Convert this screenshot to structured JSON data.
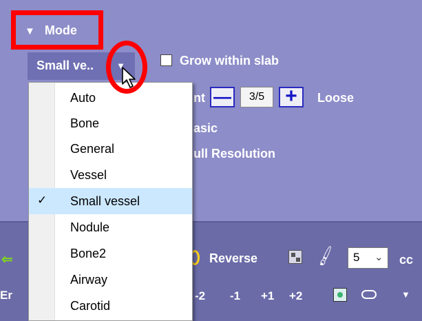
{
  "mode": {
    "header_label": "Mode",
    "collapse_icon": "triangle-down-icon",
    "selected_value": "Small ve..",
    "dropdown_icon": "chevron-down-icon"
  },
  "options": {
    "grow_within_slab_label": "Grow within slab",
    "grow_within_slab_checked": false,
    "tight_label_fragment": "nt",
    "stepper_value": "3/5",
    "loose_label": "Loose",
    "basic_label_fragment": "asic",
    "full_resolution_label_fragment": "ull Resolution"
  },
  "menu": {
    "items": [
      {
        "label": "Auto",
        "checked": false
      },
      {
        "label": "Bone",
        "checked": false
      },
      {
        "label": "General",
        "checked": false
      },
      {
        "label": "Vessel",
        "checked": false
      },
      {
        "label": "Small vessel",
        "checked": true
      },
      {
        "label": "Nodule",
        "checked": false
      },
      {
        "label": "Bone2",
        "checked": false
      },
      {
        "label": "Airway",
        "checked": false
      },
      {
        "label": "Carotid",
        "checked": false
      }
    ],
    "check_glyph": "✓"
  },
  "bottom": {
    "reverse_label": "Reverse",
    "volume_value": "5",
    "volume_unit": "cc",
    "row2_fragment": "Er",
    "step_buttons": [
      "-2",
      "-1",
      "+1",
      "+2"
    ]
  },
  "colors": {
    "panel_bg": "#8d8dc9",
    "lower_panel_bg": "#6b6ba8",
    "highlight": "#ff0000",
    "stepper_accent": "#1414c8",
    "menu_selected": "#cce8ff"
  }
}
